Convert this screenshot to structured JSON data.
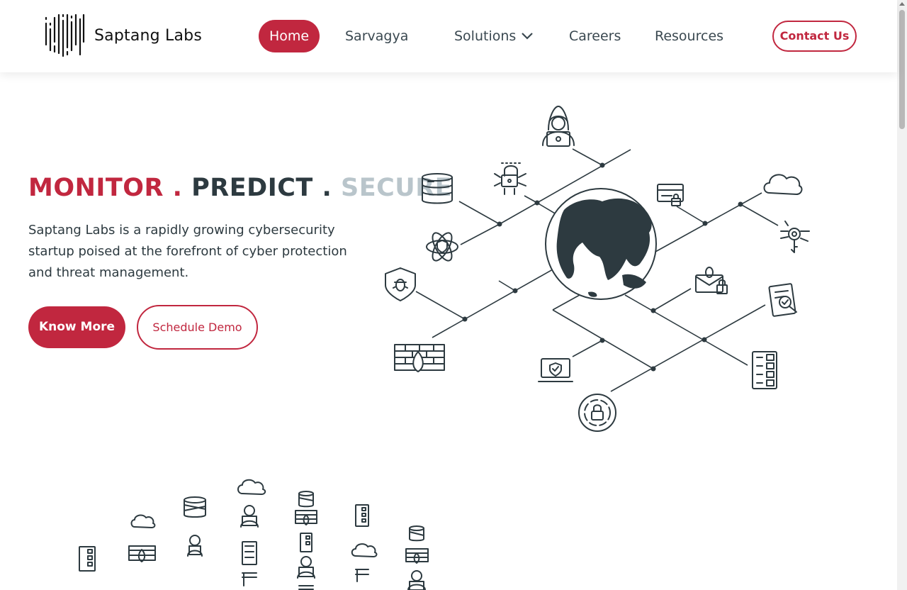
{
  "brand": {
    "name": "Saptang Labs"
  },
  "nav": {
    "home": "Home",
    "sarvagya": "Sarvagya",
    "solutions": "Solutions",
    "careers": "Careers",
    "resources": "Resources",
    "contact": "Contact Us"
  },
  "hero": {
    "tagline": {
      "word1": "MONITOR",
      "dot1": ".",
      "word2": "PREDICT",
      "dot2": ".",
      "word3": "SECURE"
    },
    "description": "Saptang Labs is a rapidly growing cybersecurity startup poised at the forefront of cyber protection and threat management.",
    "primary_button": "Know More",
    "secondary_button": "Schedule Demo"
  },
  "colors": {
    "accent": "#c1273f",
    "dark": "#2d3a40",
    "muted": "#b9c5cb"
  },
  "icons": [
    "hacker-icon",
    "database-icon",
    "network-lock-icon",
    "atom-shield-icon",
    "bug-shield-icon",
    "firewall-icon",
    "credit-card-lock-icon",
    "cloud-icon",
    "key-circuit-icon",
    "mail-bug-icon",
    "document-check-icon",
    "laptop-shield-icon",
    "server-rack-icon",
    "lock-ring-icon",
    "globe-icon"
  ]
}
